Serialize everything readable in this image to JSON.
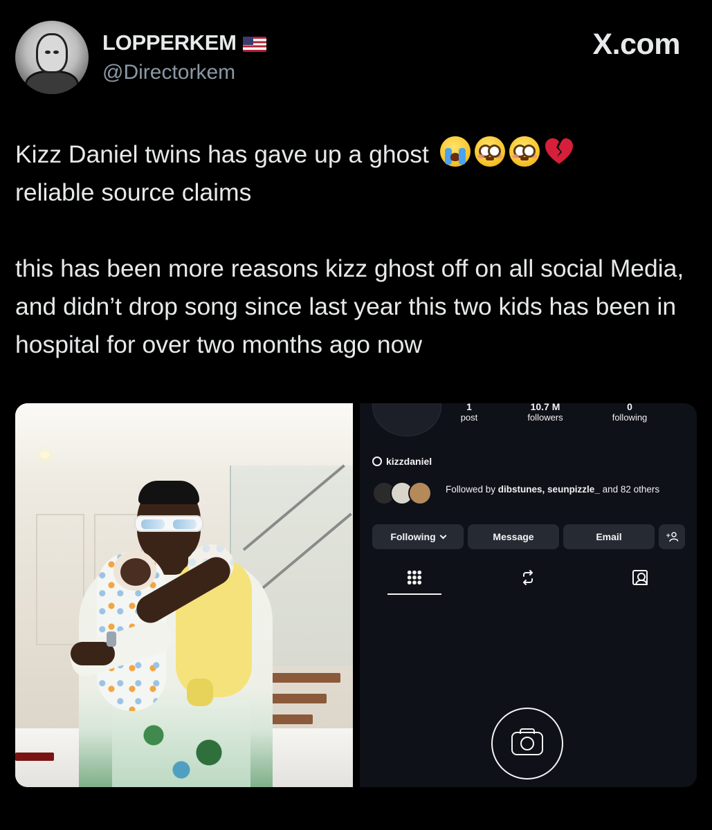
{
  "author": {
    "display_name": "LOPPERKEM",
    "flag_icon": "us-flag-icon",
    "handle": "@Directorkem"
  },
  "brand": {
    "logo_text": "X.com"
  },
  "tweet": {
    "line1": "Kizz Daniel twins has  gave up a ghost",
    "line1_emojis": [
      "loudly-crying-face-emoji",
      "flushed-face-emoji",
      "flushed-face-emoji",
      "broken-heart-emoji"
    ],
    "line2": "reliable source claims",
    "para2": "this has been more reasons kizz ghost off on all social Media, and didn’t drop song since last year this two kids has been in hospital for over two months ago now"
  },
  "media": {
    "photo_alt": "man-holding-twins-photo",
    "instagram": {
      "stats": [
        {
          "value": "1",
          "label": "post"
        },
        {
          "value": "10.7 M",
          "label": "followers"
        },
        {
          "value": "0",
          "label": "following"
        }
      ],
      "threads_handle": "kizzdaniel",
      "followed_by_prefix": "Followed by ",
      "followed_by_names": "dibstunes, seunpizzle_",
      "followed_by_suffix": " and 82 others",
      "buttons": {
        "following": "Following",
        "message": "Message",
        "email": "Email",
        "add_user": "+ዹ"
      }
    }
  },
  "colors": {
    "background": "#000000",
    "text_primary": "#e7e9ea",
    "text_secondary": "#8b98a5",
    "ig_background": "#0f1118",
    "ig_button": "#262a33"
  }
}
